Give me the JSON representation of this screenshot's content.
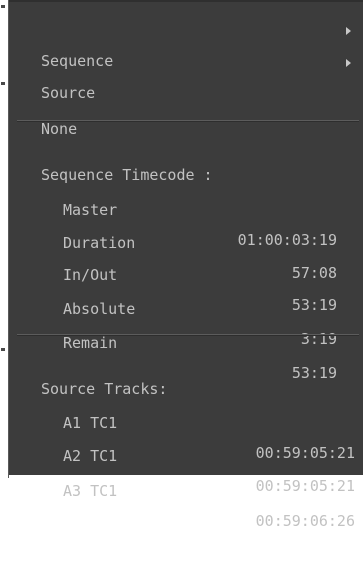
{
  "menu": {
    "items": [
      {
        "label": "Sequence"
      },
      {
        "label": "Source"
      },
      {
        "label": "None"
      }
    ]
  },
  "sequence_timecode": {
    "header": "Sequence Timecode :",
    "rows": [
      {
        "label": "Master",
        "value": "01:00:03:19"
      },
      {
        "label": "Duration",
        "value": "57:08"
      },
      {
        "label": "In/Out",
        "value": "53:19"
      },
      {
        "label": "Absolute",
        "value": "3:19"
      },
      {
        "label": "Remain",
        "value": "53:19"
      }
    ]
  },
  "source_tracks": {
    "header": "Source Tracks:",
    "rows": [
      {
        "label": "A1 TC1",
        "value": "00:59:05:21"
      },
      {
        "label": "A2 TC1",
        "value": "00:59:05:21"
      },
      {
        "label": "A3 TC1",
        "value": "00:59:06:26"
      }
    ]
  }
}
